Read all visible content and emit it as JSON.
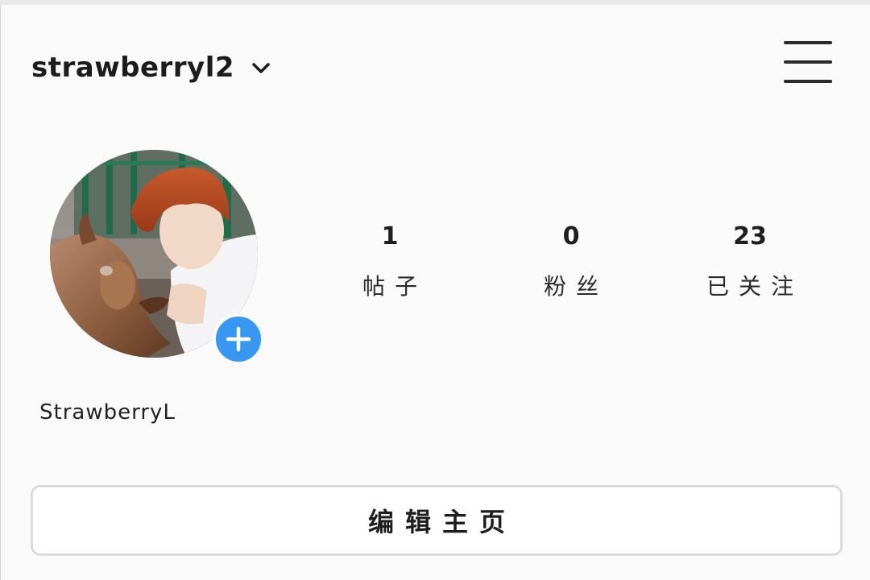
{
  "header": {
    "username": "strawberryl2"
  },
  "profile": {
    "display_name": "StrawberryL",
    "stats": [
      {
        "value": "1",
        "label": "帖子"
      },
      {
        "value": "0",
        "label": "粉丝"
      },
      {
        "value": "23",
        "label": "已关注"
      }
    ]
  },
  "actions": {
    "edit_profile_label": "编辑主页"
  },
  "icons": {
    "account_switch": "chevron-down-icon",
    "menu": "hamburger-menu-icon",
    "add_story": "plus-icon"
  },
  "colors": {
    "accent": "#3897f0",
    "background": "#fafafa",
    "text": "#262626",
    "border": "#dbdbdb"
  }
}
